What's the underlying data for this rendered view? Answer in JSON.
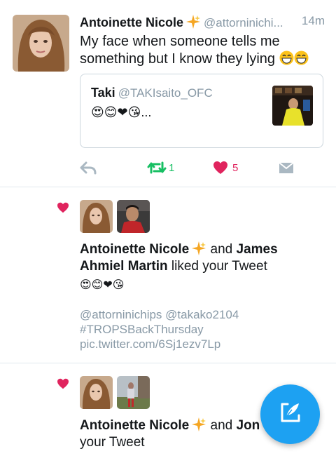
{
  "tweet": {
    "author_name": "Antoinette Nicole",
    "author_handle": "@attorninichi...",
    "time": "14m",
    "text": "My face when someone tells me something but I know they lying",
    "quote": {
      "name": "Taki",
      "handle": "@TAKIsaito_OFC",
      "text": "😍😊❤😘...",
      "thumb_icon": "quoted-video-thumbnail"
    },
    "retweet_count": "1",
    "like_count": "5"
  },
  "notifications": [
    {
      "name_a": "Antoinette Nicole",
      "joiner": "and",
      "name_b": "James Ahmiel Martin",
      "action": "liked your Tweet",
      "emoji": "😍😊❤😘",
      "sub": "@attorninichips @takako2104 #TROPSBackThursday pic.twitter.com/6Sj1ezv7Lp"
    },
    {
      "name_a": "Antoinette Nicole",
      "joiner": "and",
      "name_b": "Jon",
      "action": "your Tweet"
    }
  ],
  "colors": {
    "accent": "#1da1f2",
    "like": "#e0245e",
    "retweet": "#17bf63",
    "muted": "#8899a6",
    "divider": "#e1e8ed"
  },
  "icons": [
    "sparkle-icon",
    "reply-icon",
    "retweet-icon",
    "like-icon",
    "dm-icon",
    "compose-icon",
    "heart-icon"
  ]
}
